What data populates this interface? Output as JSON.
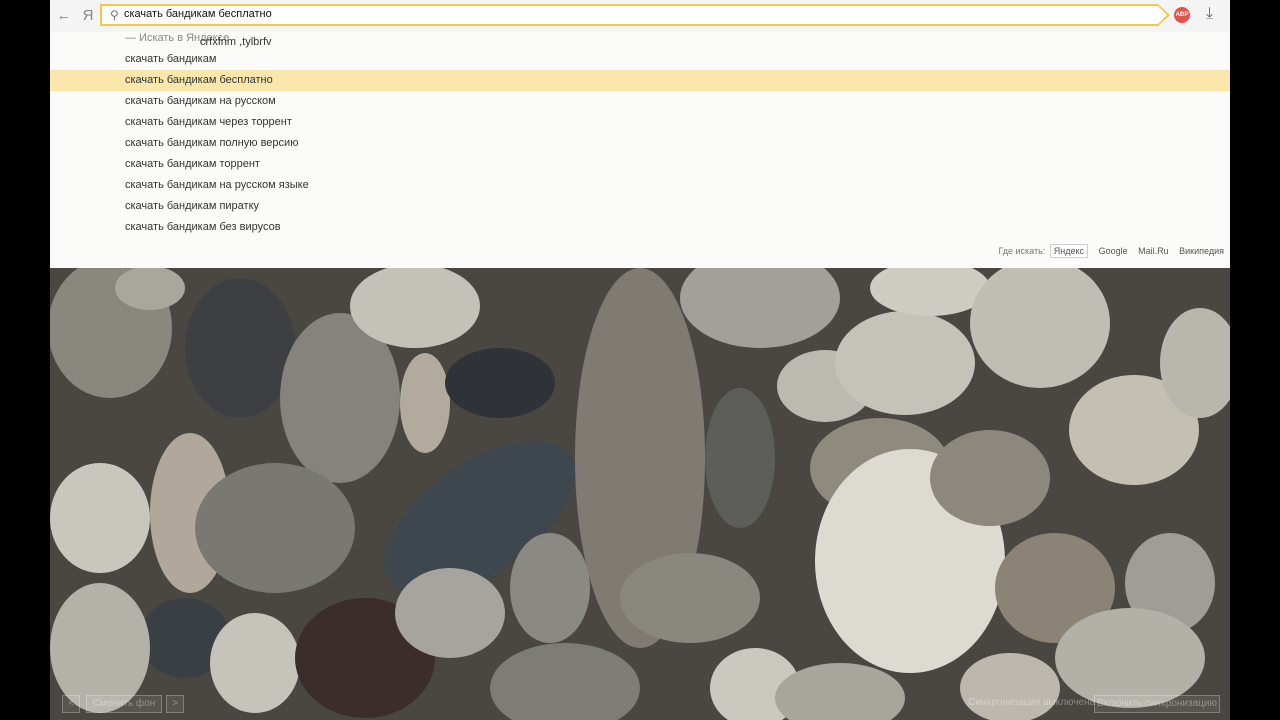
{
  "toolbar": {
    "back_icon": "arrow-left",
    "yandex_label": "Я",
    "address_value": "скачать бандикам бесплатно",
    "adblock_label": "ABP",
    "download_icon": "download"
  },
  "suggestions": {
    "first": {
      "text": "crfxfnm ,tylbrfv",
      "hint": "— Искать в Яндексе"
    },
    "items": [
      "скачать бандикам",
      "скачать бандикам бесплатно",
      "скачать бандикам на русском",
      "скачать бандикам через торрент",
      "скачать бандикам полную версию",
      "скачать бандикам торрент",
      "скачать бандикам на русском языке",
      "скачать бандикам пиратку",
      "скачать бандикам без вирусов"
    ]
  },
  "search_engines": {
    "label": "Где искать:",
    "options": [
      "Яндекс",
      "Google",
      "Mail.Ru",
      "Википедия"
    ]
  },
  "bottom": {
    "prev": "<",
    "change_bg": "Сменить фон",
    "next": ">",
    "sync_status": "Синхронизация выключена",
    "enable_sync": "Включить синхронизацию"
  },
  "colors": {
    "highlight": "#fbe7ab",
    "omnibox_border": "#f0c94c"
  }
}
